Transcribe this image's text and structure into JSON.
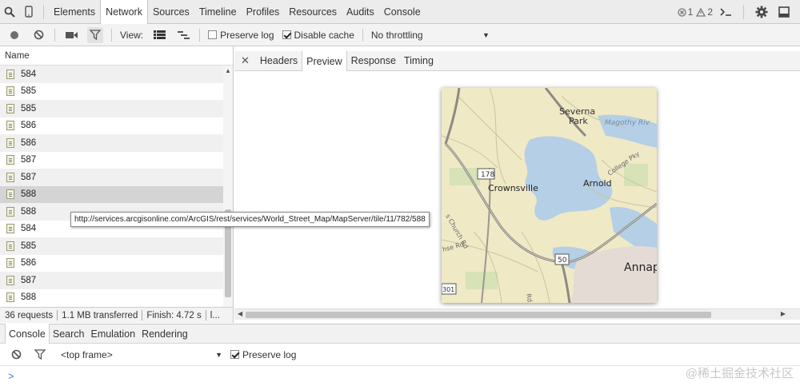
{
  "top_tabs": [
    "Elements",
    "Network",
    "Sources",
    "Timeline",
    "Profiles",
    "Resources",
    "Audits",
    "Console"
  ],
  "active_top_tab": "Network",
  "status_counts": {
    "errors": "1",
    "warnings": "2"
  },
  "toolbar": {
    "view_label": "View:",
    "preserve_log": "Preserve log",
    "disable_cache": "Disable cache",
    "throttling": "No throttling"
  },
  "name_header": "Name",
  "requests": [
    "584",
    "585",
    "585",
    "586",
    "586",
    "587",
    "587",
    "588",
    "588",
    "584",
    "585",
    "586",
    "587",
    "588"
  ],
  "tooltip": "http://services.arcgisonline.com/ArcGIS/rest/services/World_Street_Map/MapServer/tile/11/782/588",
  "detail_tabs": [
    "Headers",
    "Preview",
    "Response",
    "Timing"
  ],
  "active_detail_tab": "Preview",
  "map": {
    "labels": {
      "severna": "Severna",
      "park": "Park",
      "magothy": "Magothy Riv",
      "crownsville": "Crownsville",
      "arnold": "Arnold",
      "college": "College Pky",
      "annap": "Annap",
      "route178": "178",
      "route50": "50",
      "route301": "301",
      "rd": "Rd",
      "church": "s Church Rd",
      "shd": "hse Rd"
    }
  },
  "status": {
    "requests": "36 requests",
    "transferred": "1.1 MB transferred",
    "finish": "Finish: 4.72 s",
    "more": "l..."
  },
  "drawer_tabs": [
    "Console",
    "Search",
    "Emulation",
    "Rendering"
  ],
  "active_drawer_tab": "Console",
  "console": {
    "frame": "<top frame>",
    "preserve_log": "Preserve log",
    "prompt": ">"
  },
  "watermark": "@稀土掘金技术社区"
}
